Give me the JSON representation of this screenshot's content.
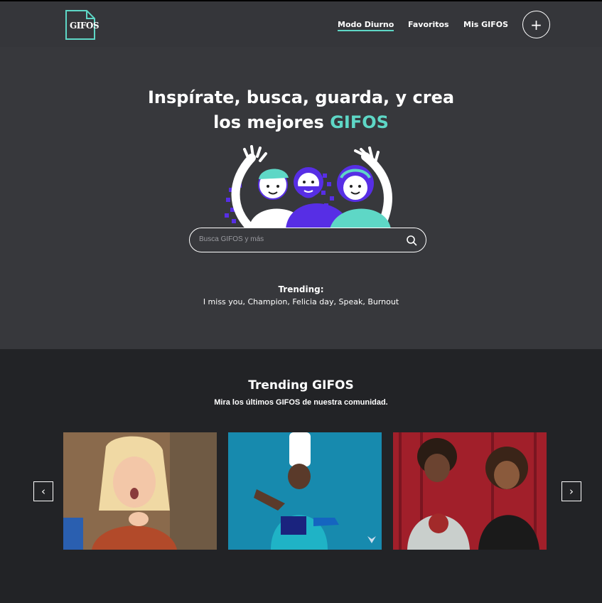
{
  "header": {
    "logo_text": "GIFOS",
    "nav": [
      "Modo Diurno",
      "Favoritos",
      "Mis GIFOS"
    ],
    "add_label": "+"
  },
  "hero": {
    "headline_line1": "Inspírate, busca, guarda, y crea",
    "headline_line2_prefix": "los mejores ",
    "headline_line2_accent": "GIFOS",
    "search_placeholder": "Busca GIFOS y más",
    "trending_label": "Trending:",
    "trending_terms": "I miss you, Champion, Felicia day, Speak, Burnout"
  },
  "trending_gifos": {
    "title": "Trending GIFOS",
    "subtitle": "Mira los últimos GIFOS de nuestra comunidad.",
    "prev_arrow": "‹",
    "next_arrow": "›"
  },
  "colors": {
    "accent": "#5ed7c6",
    "purple": "#572ee5",
    "background": "#37383c",
    "section_background": "#222326"
  }
}
